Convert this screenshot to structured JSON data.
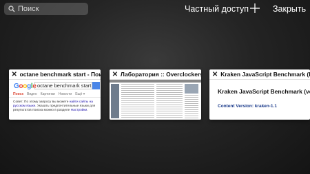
{
  "search": {
    "placeholder": "Поиск"
  },
  "toolbar": {
    "private_label": "Частный доступ",
    "close_label": "Закрыть"
  },
  "tabs": [
    {
      "title": "octane benchmark start - Поиск...",
      "search_query": "octane benchmark start",
      "nav": [
        "Поиск",
        "Видео",
        "Картинки",
        "Новости",
        "Ещё ▾"
      ],
      "tip_a": "Совет: По этому запросу вы можете ",
      "tip_link": "найти сайты на русском языке",
      "tip_b": ". Указать предпочтительные языки для результатов поиска можно в разделе ",
      "tip_link2": "Настройки",
      "tip_end": "."
    },
    {
      "title": "Лаборатория :: Overclockers.ru"
    },
    {
      "title": "Kraken JavaScript Benchmark (k...",
      "page_heading": "Kraken JavaScript Benchmark (ve",
      "version": "Content Version: kraken-1.1"
    }
  ]
}
